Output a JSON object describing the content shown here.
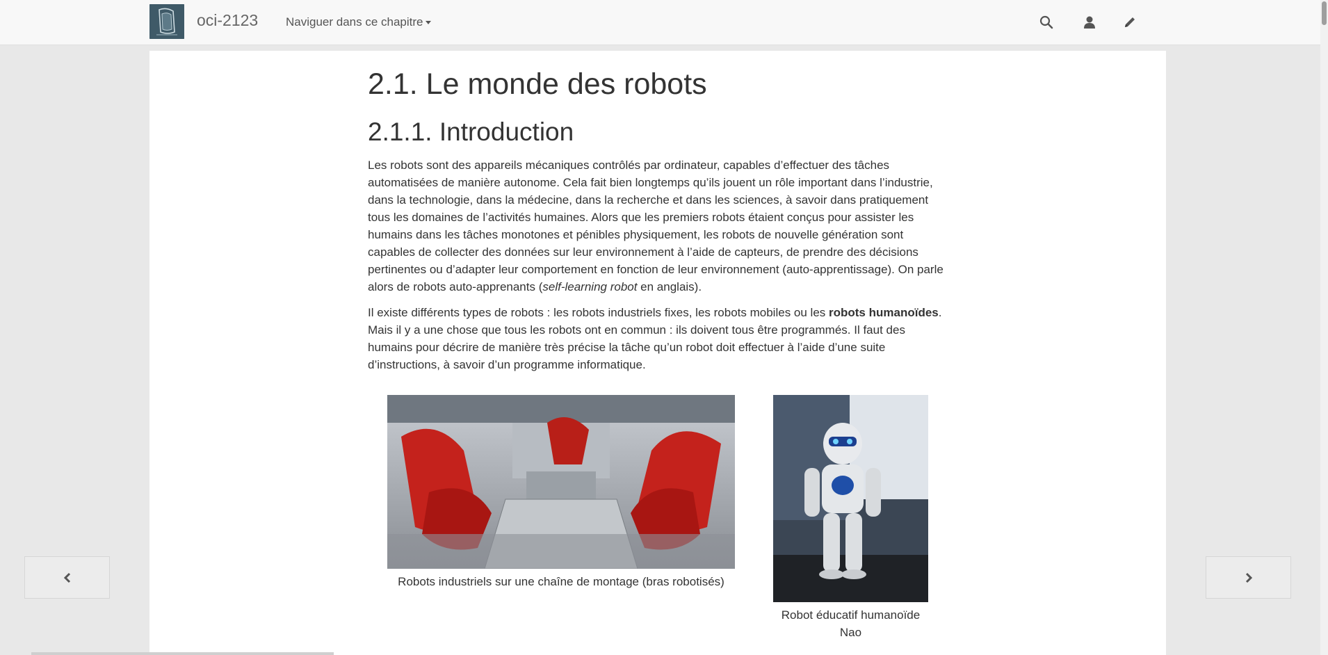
{
  "navbar": {
    "brand": "oci-2123",
    "chapter_nav_label": "Naviguer dans ce chapitre",
    "icons": [
      "search-icon",
      "user-icon",
      "pencil-icon"
    ]
  },
  "content": {
    "title": "2.1. Le monde des robots",
    "subtitle": "2.1.1. Introduction",
    "paragraph1_before_italic": "Les robots sont des appareils mécaniques contrôlés par ordinateur, capables d’effectuer des tâches automatisées de manière autonome. Cela fait bien longtemps qu’ils jouent un rôle important dans l’industrie, dans la technologie, dans la médecine, dans la recherche et dans les sciences, à savoir dans pratiquement tous les domaines de l’activités humaines. Alors que les premiers robots étaient conçus pour assister les humains dans les tâches monotones et pénibles physiquement, les robots de nouvelle génération sont capables de collecter des données sur leur environnement à l’aide de capteurs, de prendre des décisions pertinentes ou d’adapter leur comportement en fonction de leur environnement (auto-apprentissage). On parle alors de robots auto-apprenants (",
    "paragraph1_italic": "self-learning robot",
    "paragraph1_after_italic": " en anglais).",
    "paragraph2_before_bold": "Il existe différents types de robots : les robots industriels fixes, les robots mobiles ou les ",
    "paragraph2_bold": "robots humanoïdes",
    "paragraph2_after_bold": ". Mais il y a une chose que tous les robots ont en commun : ils doivent tous être programmés. Il faut des humains pour décrire de manière très précise la tâche qu’un robot doit effectuer à l’aide d’une suite d’instructions, à savoir d’un programme informatique.",
    "figure1_caption": "Robots industriels sur une chaîne de montage (bras robotisés)",
    "figure2_caption": "Robot éducatif humanoïde Nao"
  },
  "side_nav": {
    "prev_icon": "chevron-left-icon",
    "next_icon": "chevron-right-icon"
  }
}
